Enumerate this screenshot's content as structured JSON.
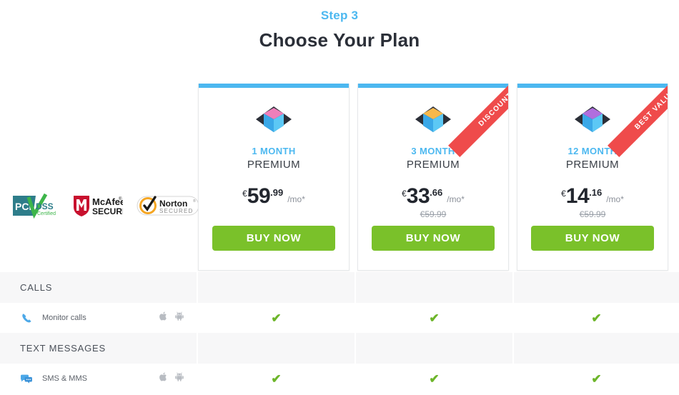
{
  "header": {
    "step": "Step 3",
    "title": "Choose Your Plan",
    "step_color": "#4cb8f0"
  },
  "trust_badges": [
    {
      "name": "pci-dss-badge",
      "line1": "PCI",
      "line2": "DSS",
      "line3": "Certified"
    },
    {
      "name": "mcafee-secure-badge",
      "line1": "McAfee",
      "line2": "SECURE"
    },
    {
      "name": "norton-secured-badge",
      "line1": "Norton",
      "line2": "SECURED"
    }
  ],
  "plans": [
    {
      "id": "1-month",
      "term": "1 MONTH",
      "tier": "PREMIUM",
      "currency": "€",
      "price_int": "59",
      "price_dec": ".99",
      "per": "/mo*",
      "old_price": "",
      "buy_label": "BUY NOW",
      "ribbon": "",
      "logo_top_color": "#ef7fba",
      "accent_color": "#4cb8f0",
      "button_color": "#7ac12a"
    },
    {
      "id": "3-month",
      "term": "3 MONTH",
      "tier": "PREMIUM",
      "currency": "€",
      "price_int": "33",
      "price_dec": ".66",
      "per": "/mo*",
      "old_price": "€59.99",
      "buy_label": "BUY NOW",
      "ribbon": "DISCOUNT",
      "logo_top_color": "#f7b84b",
      "accent_color": "#4cb8f0",
      "button_color": "#7ac12a"
    },
    {
      "id": "12-month",
      "term": "12 MONTH",
      "tier": "PREMIUM",
      "currency": "€",
      "price_int": "14",
      "price_dec": ".16",
      "per": "/mo*",
      "old_price": "€59.99",
      "buy_label": "BUY NOW",
      "ribbon": "BEST VALUE",
      "logo_top_color": "#b06ede",
      "accent_color": "#4cb8f0",
      "button_color": "#7ac12a"
    }
  ],
  "feature_table": {
    "sections": [
      {
        "title": "CALLS",
        "features": [
          {
            "name": "Monitor calls",
            "icon": "phone-icon",
            "platforms": [
              "apple-icon",
              "android-icon"
            ],
            "availability": [
              "check",
              "check",
              "check"
            ]
          }
        ]
      },
      {
        "title": "TEXT MESSAGES",
        "features": [
          {
            "name": "SMS & MMS",
            "icon": "chat-icon",
            "platforms": [
              "apple-icon",
              "android-icon"
            ],
            "availability": [
              "check",
              "check",
              "check"
            ]
          }
        ]
      }
    ],
    "check_glyph": "✔",
    "check_color": "#6cb529"
  }
}
